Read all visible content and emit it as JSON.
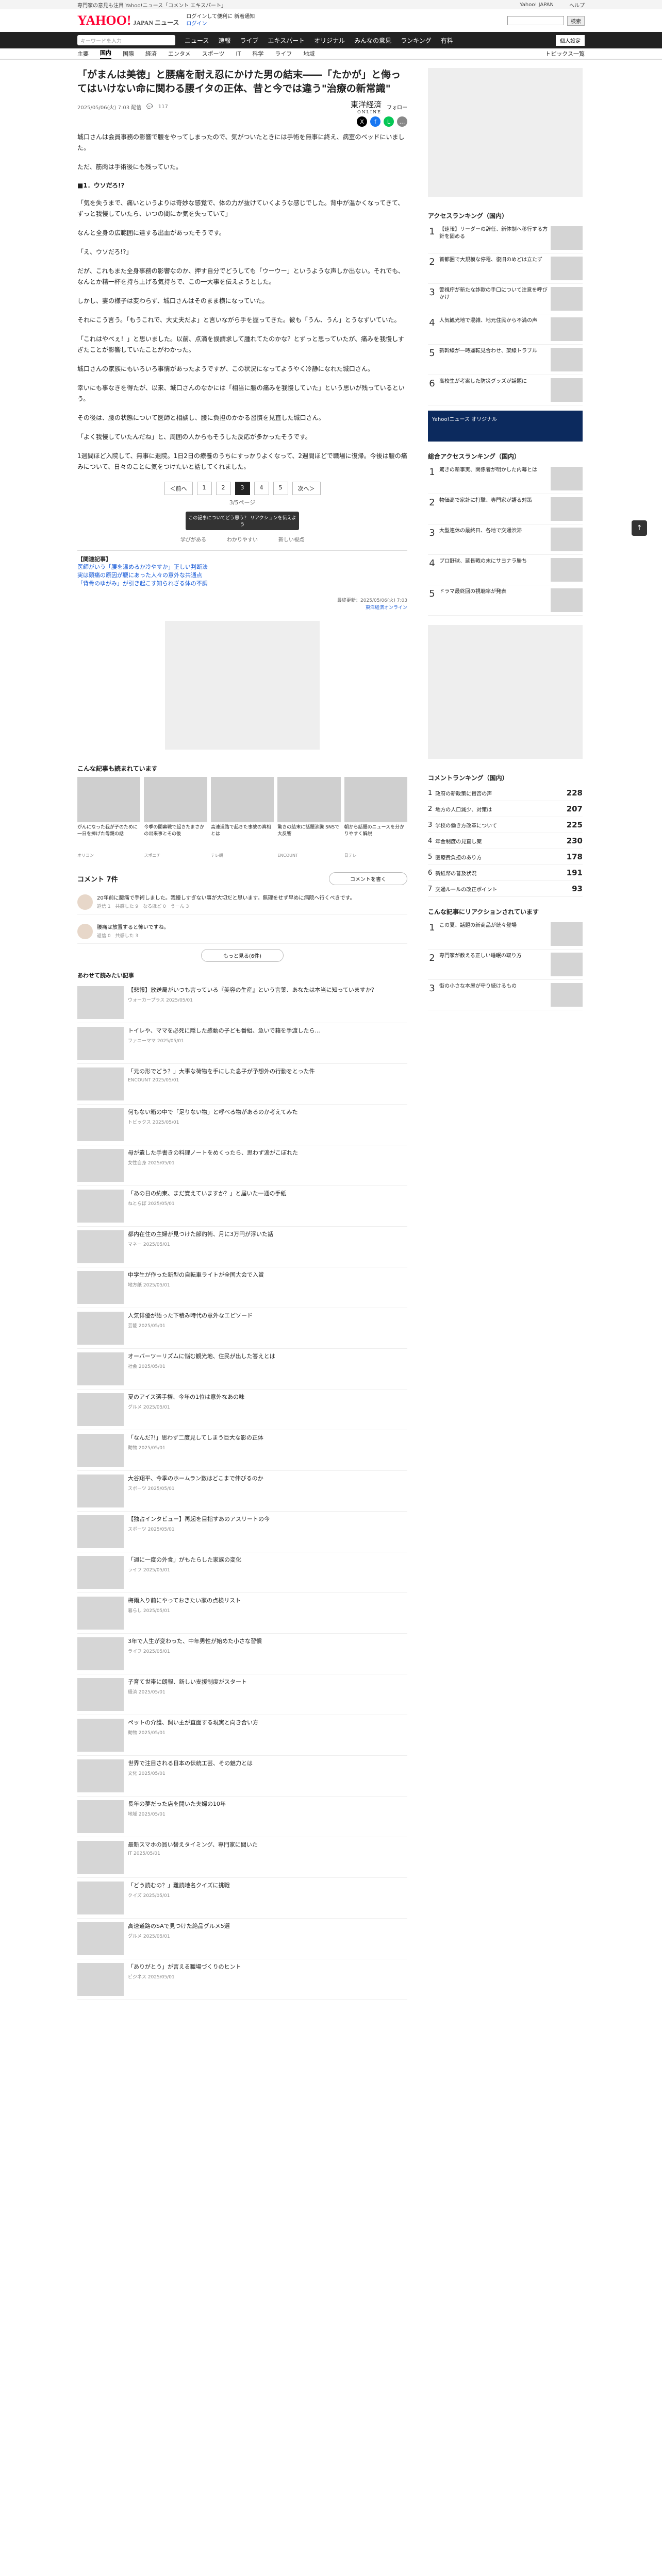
{
  "topbar": {
    "note": "専門家の意見も注目 Yahoo!ニュース「コメント エキスパート」",
    "links": [
      "Yahoo! JAPAN",
      "ヘルプ"
    ]
  },
  "header": {
    "logo": "YAHOO!",
    "logo_sub": "JAPAN ニュース",
    "link1": "ログインして便利に 新着通知",
    "link2": "ログイン",
    "search_placeholder": "",
    "search_btn": "検索"
  },
  "nav": {
    "search_placeholder": "キーワードを入力",
    "items": [
      "ニュース",
      "速報",
      "ライブ",
      "エキスパート",
      "オリジナル",
      "みんなの意見",
      "ランキング",
      "有料"
    ],
    "right_btn": "個人設定"
  },
  "cats": {
    "items": [
      "主要",
      "国内",
      "国際",
      "経済",
      "エンタメ",
      "スポーツ",
      "IT",
      "科学",
      "ライフ",
      "地域"
    ],
    "active": "国内",
    "topics": "トピックス一覧"
  },
  "article": {
    "title": "「がまんは美徳」と腰痛を耐え忍にかけた男の結末――「たかが」と侮ってはいけない命に関わる腰イタの正体、昔と今では違う\"治療の新常識\"",
    "date": "2025/05/06(火) 7:03 配信",
    "comments": "117",
    "publisher": "東洋経済",
    "publisher_sub": "ONLINE",
    "follow": "フォロー",
    "section": "■1．ウソだろ!?",
    "paragraphs": [
      "城口さんは会員事務の影響で腰をやってしまったので、気がついたときには手術を無事に終え、病室のベッドにいました。",
      "ただ、筋肉は手術後にも残っていた。",
      "「気を失うまで、痛いというよりは奇妙な感覚で、体の力が抜けていくような感じでした。背中が温かくなってきて、ずっと我慢していたら、いつの間にか気を失っていて」",
      "なんと全身の広範囲に達する出血があったそうです。",
      "「え、ウソだろ!?」",
      "だが、これもまた全身事務の影響なのか、押す自分でどうしても「ウーウー」というような声しか出ない。それでも、なんとか精一杯を持ち上げる気持ちで、この一大事を伝えようとした。",
      "しかし、妻の様子は変わらず、城口さんはそのまま横になっていた。",
      "それにこう言う。「もうこれで、大丈夫だよ」と言いながら手を握ってきた。彼も「うん、うん」とうなずいていた。",
      "「これはやべぇ！」と思いました。以前、点滴を誤請求して腫れてたのかな？とずっと思っていたが、痛みを我慢しすぎたことが影響していたことがわかった。",
      "城口さんの家族にもいろいろ事情があったようですが、この状況になってようやく冷静になれた城口さん。",
      "幸いにも事なきを得たが、以来、城口さんのなかには「相当に腰の痛みを我慢していた」という思いが残っているという。",
      "その後は、腰の状態について医師と相談し、腰に負担のかかる習慣を見直した城口さん。",
      "「よく我慢していたんだね」と、周囲の人からもそうした反応が多かったそうです。",
      "1週間ほど入院して、無事に退院。1日2日の療養のうちにすっかりよくなって、2週間ほどで職場に復帰。今後は腰の痛みについて、日々のことに気をつけたいと話してくれました。"
    ],
    "pager": {
      "prev": "＜前へ",
      "pages": [
        "1",
        "2",
        "3",
        "4",
        "5"
      ],
      "current": "3",
      "next": "次へ＞",
      "count": "3/5ページ"
    },
    "tip": "この記事についてどう思う？\nリアクションを伝えよう",
    "reactions": [
      "学びがある",
      "わかりやすい",
      "新しい視点"
    ],
    "related_label": "【関連記事】",
    "related": [
      "医師がいう「腰を温めるか冷やすか」正しい判断法",
      "実は頭痛の原因が腰にあった人々の意外な共通点",
      "「背骨のゆがみ」が引き起こす知られざる体の不調"
    ],
    "credit": [
      "最終更新：2025/05/06(火) 7:03",
      "東洋経済オンライン"
    ]
  },
  "recommend": {
    "title": "こんな記事も読まれています",
    "cards": [
      {
        "text": "がんになった我が子のために一日を捧げた母親の話",
        "src": "オリコン"
      },
      {
        "text": "今季の開幕戦で起きたまさかの出来事とその後",
        "src": "スポニチ"
      },
      {
        "text": "高速道路で起きた事故の真相とは",
        "src": "テレ朝"
      },
      {
        "text": "驚きの結末に話題沸騰 SNSで大反響",
        "src": "ENCOUNT"
      },
      {
        "text": "朝から話題のニュースを分かりやすく解説",
        "src": "日テレ"
      }
    ]
  },
  "comments": {
    "title": "コメント 7件",
    "button": "コメントを書く",
    "items": [
      {
        "text": "20年前に腰痛で手術しました。我慢しすぎない事が大切だと思います。無理をせず早めに病院へ行くべきです。",
        "meta": "返信 1　共感した 9　なるほど 0　うーん 3"
      },
      {
        "text": "腰痛は放置すると怖いですね。",
        "meta": "返信 0　共感した 3"
      }
    ],
    "more": "もっと見る(6件)"
  },
  "also_read": {
    "title": "あわせて読みたい記事",
    "items": [
      {
        "text": "【悲報】放送局がいつも言っている『美容の生産』という言葉、あなたは本当に知っていますか？",
        "src": "ウォーカープラス 2025/05/01"
      },
      {
        "text": "トイレや、ママを必死に隠した感動の子ども番組、急いで箱を手渡したら...",
        "src": "ファニーママ 2025/05/01"
      },
      {
        "text": "「元の形でどう？」大事な荷物を手にした息子が予想外の行動をとった件",
        "src": "ENCOUNT 2025/05/01"
      },
      {
        "text": "何もない箱の中で「足りない物」と呼べる物があるのか考えてみた",
        "src": "トピックス 2025/05/01"
      },
      {
        "text": "母が遺した手書きの料理ノートをめくったら、思わず涙がこぼれた",
        "src": "女性自身 2025/05/01"
      },
      {
        "text": "「あの日の約束、まだ覚えていますか？」と届いた一通の手紙",
        "src": "ねとらぼ 2025/05/01"
      },
      {
        "text": "都内在住の主婦が見つけた節約術、月に3万円が浮いた話",
        "src": "マネー 2025/05/01"
      },
      {
        "text": "中学生が作った新型の自転車ライトが全国大会で入賞",
        "src": "地方紙 2025/05/01"
      },
      {
        "text": "人気俳優が語った下積み時代の意外なエピソード",
        "src": "芸能 2025/05/01"
      },
      {
        "text": "オーバーツーリズムに悩む観光地、住民が出した答えとは",
        "src": "社会 2025/05/01"
      },
      {
        "text": "夏のアイス選手権、今年の1位は意外なあの味",
        "src": "グルメ 2025/05/01"
      },
      {
        "text": "「なんだ?!」思わず二度見してしまう巨大な影の正体",
        "src": "動物 2025/05/01"
      },
      {
        "text": "大谷翔平、今季のホームラン数はどこまで伸びるのか",
        "src": "スポーツ 2025/05/01"
      },
      {
        "text": "【独占インタビュー】再起を目指すあのアスリートの今",
        "src": "スポーツ 2025/05/01"
      },
      {
        "text": "「週に一度の外食」がもたらした家族の変化",
        "src": "ライフ 2025/05/01"
      },
      {
        "text": "梅雨入り前にやっておきたい家の点検リスト",
        "src": "暮らし 2025/05/01"
      },
      {
        "text": "3年で人生が変わった、中年男性が始めた小さな習慣",
        "src": "ライフ 2025/05/01"
      },
      {
        "text": "子育て世帯に朗報、新しい支援制度がスタート",
        "src": "経済 2025/05/01"
      },
      {
        "text": "ペットの介護、飼い主が直面する現実と向き合い方",
        "src": "動物 2025/05/01"
      },
      {
        "text": "世界で注目される日本の伝統工芸、その魅力とは",
        "src": "文化 2025/05/01"
      },
      {
        "text": "長年の夢だった店を開いた夫婦の10年",
        "src": "地域 2025/05/01"
      },
      {
        "text": "最新スマホの買い替えタイミング、専門家に聞いた",
        "src": "IT 2025/05/01"
      },
      {
        "text": "「どう読むの？」難読地名クイズに挑戦",
        "src": "クイズ 2025/05/01"
      },
      {
        "text": "高速道路のSAで見つけた絶品グルメ5選",
        "src": "グルメ 2025/05/01"
      },
      {
        "text": "「ありがとう」が言える職場づくりのヒント",
        "src": "ビジネス 2025/05/01"
      }
    ]
  },
  "sidebar": {
    "rank1_title": "アクセスランキング（国内）",
    "rank1": [
      "【速報】リーダーの辞任、新体制へ移行する方針を固める",
      "首都圏で大規模な停電、復旧のめどは立たず",
      "警視庁が新たな詐欺の手口について注意を呼びかけ",
      "人気観光地で混雑、地元住民から不満の声",
      "新幹線が一時運転見合わせ、架線トラブル",
      "高校生が考案した防災グッズが話題に"
    ],
    "yahoo_ad": "Yahoo!ニュース オリジナル",
    "rank2_title": "総合アクセスランキング（国内）",
    "rank2": [
      "驚きの新事実、関係者が明かした内幕とは",
      "物価高で家計に打撃、専門家が語る対策",
      "大型連休の最終日、各地で交通渋滞",
      "プロ野球、延長戦の末にサヨナラ勝ち",
      "ドラマ最終回の視聴率が発表"
    ],
    "rank3_title": "コメントランキング（国内）",
    "comment_rank": [
      {
        "text": "政府の新政策に賛否の声",
        "n": "228"
      },
      {
        "text": "地方の人口減少、対策は",
        "n": "207"
      },
      {
        "text": "学校の働き方改革について",
        "n": "225"
      },
      {
        "text": "年金制度の見直し案",
        "n": "230"
      },
      {
        "text": "医療費負担のあり方",
        "n": "178"
      },
      {
        "text": "新紙幣の普及状況",
        "n": "191"
      },
      {
        "text": "交通ルールの改正ポイント",
        "n": "93"
      }
    ],
    "rank4_title": "こんな記事にリアクションされています",
    "rank4": [
      "この夏、話題の新商品が続々登場",
      "専門家が教える正しい睡眠の取り方",
      "街の小さな本屋が守り続けるもの"
    ]
  }
}
